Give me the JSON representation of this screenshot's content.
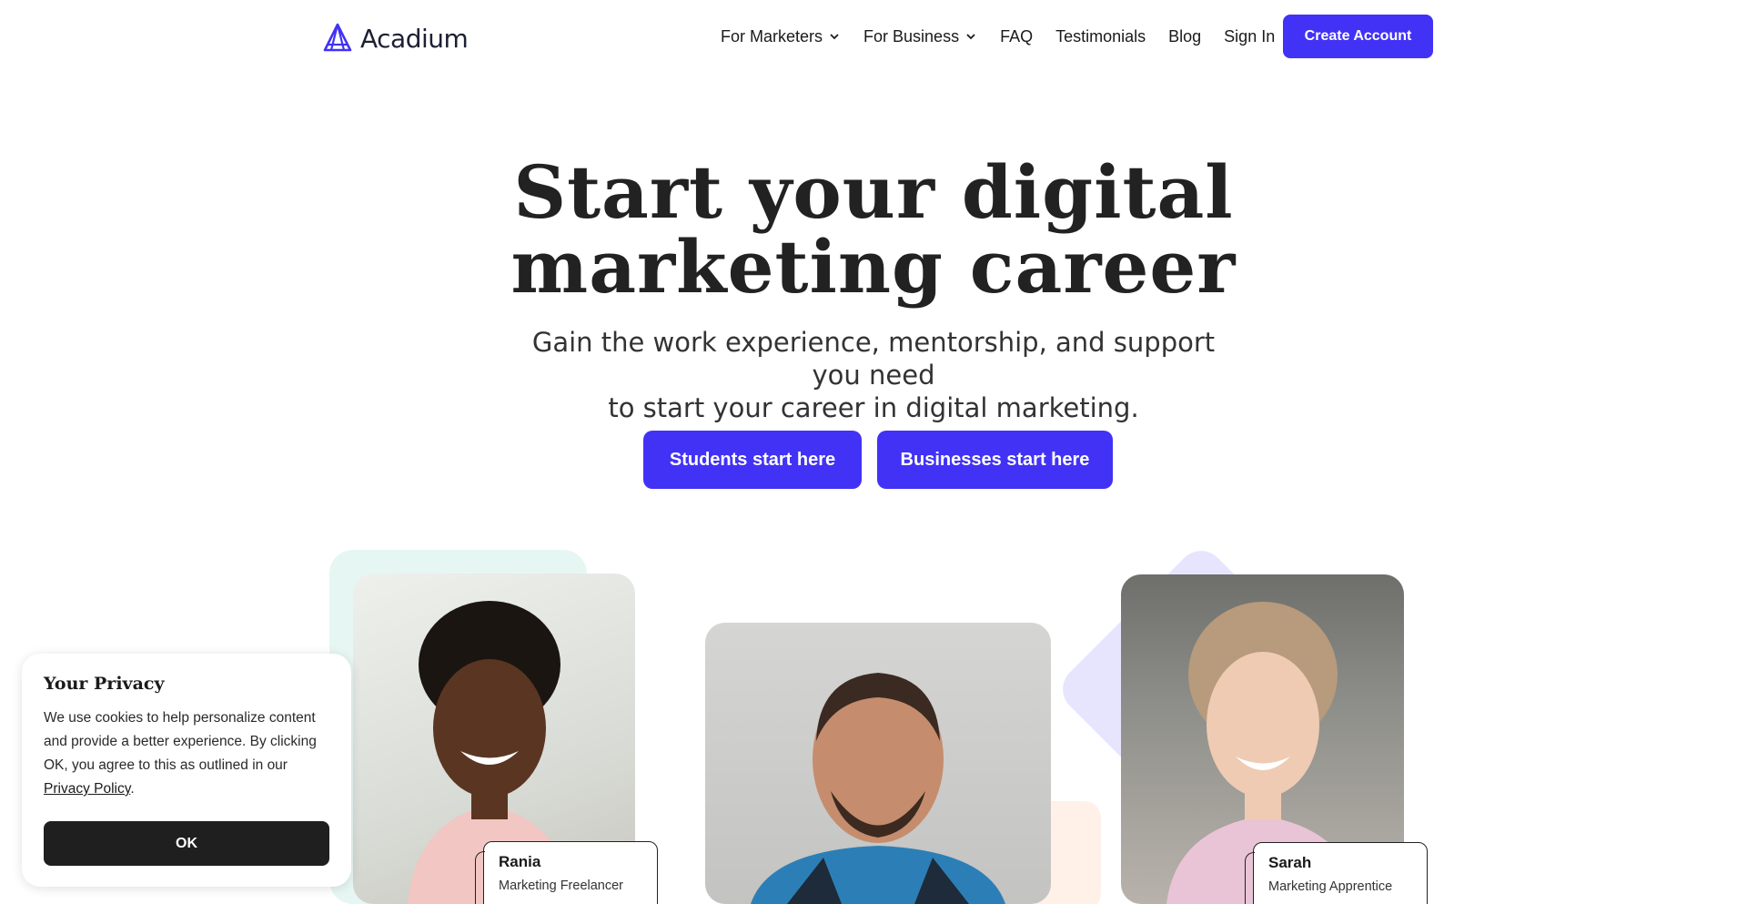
{
  "header": {
    "logo_text": "Acadium",
    "nav": {
      "for_marketers": "For Marketers",
      "for_business": "For Business",
      "faq": "FAQ",
      "testimonials": "Testimonials",
      "blog": "Blog",
      "sign_in": "Sign In"
    },
    "create_account": "Create Account"
  },
  "hero": {
    "title_line1": "Start your digital",
    "title_line2": "marketing career",
    "subtitle_line1": "Gain the work experience, mentorship, and support you need",
    "subtitle_line2": "to start your career in digital marketing.",
    "cta_students": "Students start here",
    "cta_businesses": "Businesses start here"
  },
  "profiles": [
    {
      "name": "Rania",
      "role": "Marketing Freelancer"
    },
    {
      "name": "Sarah",
      "role": "Marketing Apprentice"
    }
  ],
  "cookie": {
    "title": "Your Privacy",
    "body": "We use cookies to help personalize content and provide a better experience. By clicking OK, you agree to this as outlined in our ",
    "link": "Privacy Policy",
    "suffix": ".",
    "ok": "OK"
  },
  "colors": {
    "brand": "#4232f5",
    "dark_button": "#1f1f1f"
  },
  "icons": {
    "logo": "acadium-logo-icon",
    "dropdown": "chevron-down-icon"
  }
}
